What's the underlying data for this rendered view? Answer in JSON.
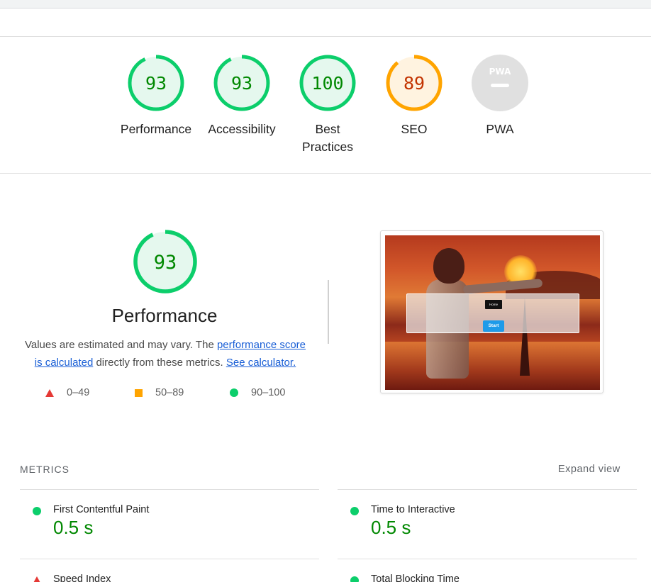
{
  "gauges": [
    {
      "score": "93",
      "fraction": 0.93,
      "label": "Performance",
      "status": "pass"
    },
    {
      "score": "93",
      "fraction": 0.93,
      "label": "Accessibility",
      "status": "pass"
    },
    {
      "score": "100",
      "fraction": 1.0,
      "label": "Best Practices",
      "status": "pass"
    },
    {
      "score": "89",
      "fraction": 0.89,
      "label": "SEO",
      "status": "average"
    },
    {
      "score": "",
      "fraction": 0,
      "label": "PWA",
      "badge": "PWA",
      "status": "na"
    }
  ],
  "colors": {
    "pass_ring": "#0cce6b",
    "pass_fill": "#e5f8ee",
    "pass_text": "#008800",
    "average_ring": "#ffa400",
    "average_fill": "#fff3e0",
    "average_text": "#c33300",
    "fail": "#e53935",
    "na_fill": "#e0e0e0",
    "link": "#1a5fd6"
  },
  "performance": {
    "score": "93",
    "fraction": 0.93,
    "title": "Performance",
    "desc_part1": "Values are estimated and may vary. The ",
    "link_score": "performance score is calculated",
    "desc_part2": " directly from these metrics. ",
    "link_calculator": "See calculator.",
    "legend": {
      "fail": "0–49",
      "average": "50–89",
      "pass": "90–100"
    }
  },
  "screenshot": {
    "home_label": "Home",
    "start_label": "Start"
  },
  "metrics": {
    "section_label": "METRICS",
    "expand_label": "Expand view",
    "items": [
      {
        "name": "First Contentful Paint",
        "value": "0.5 s",
        "status": "pass"
      },
      {
        "name": "Time to Interactive",
        "value": "0.5 s",
        "status": "pass"
      },
      {
        "name": "Speed Index",
        "value": "",
        "status": "fail"
      },
      {
        "name": "Total Blocking Time",
        "value": "",
        "status": "pass"
      }
    ]
  }
}
